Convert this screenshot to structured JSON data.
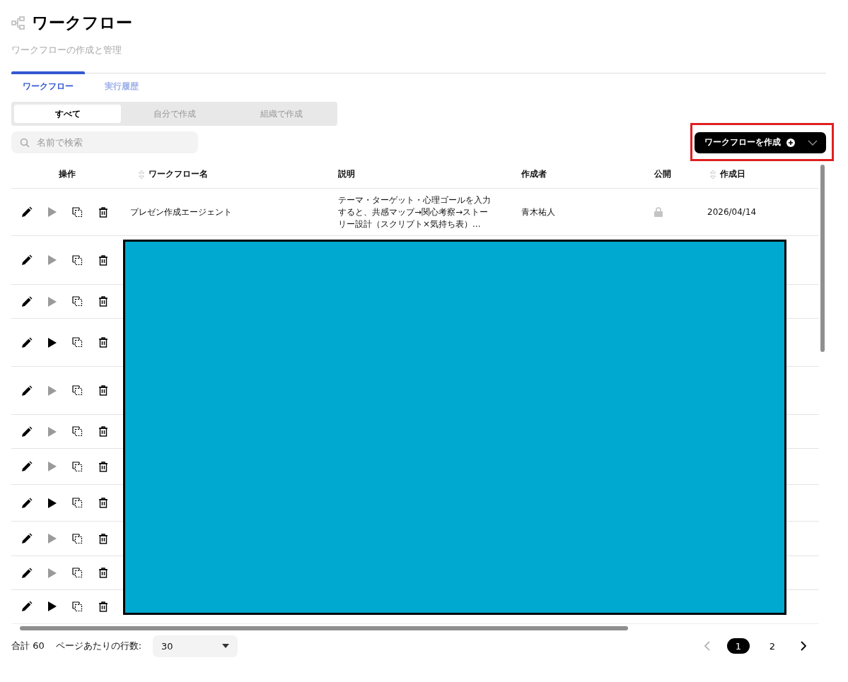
{
  "page": {
    "title": "ワークフロー",
    "subtitle": "ワークフローの作成と管理"
  },
  "tabs": [
    {
      "label": "ワークフロー",
      "selected": true
    },
    {
      "label": "実行履歴",
      "selected": false
    }
  ],
  "filters": [
    {
      "label": "すべて",
      "selected": true
    },
    {
      "label": "自分で作成",
      "selected": false
    },
    {
      "label": "組織で作成",
      "selected": false
    }
  ],
  "search": {
    "placeholder": "名前で検索"
  },
  "create_button": {
    "label": "ワークフローを作成"
  },
  "table": {
    "columns": [
      {
        "label": "操作",
        "sortable": false
      },
      {
        "label": "ワークフロー名",
        "sortable": true
      },
      {
        "label": "説明",
        "sortable": false
      },
      {
        "label": "作成者",
        "sortable": false
      },
      {
        "label": "公開",
        "sortable": false
      },
      {
        "label": "作成日",
        "sortable": true
      }
    ],
    "rows": [
      {
        "name": "プレゼン作成エージェント",
        "description": "テーマ・ターゲット・心理ゴールを入力すると、共感マップ→関心考察→ストーリー設計（スクリプト×気持ち表）...",
        "author": "青木祐人",
        "public": false,
        "date": "2026/04/14",
        "runnable": false
      },
      {
        "runnable": false
      },
      {
        "runnable": false
      },
      {
        "runnable": true
      },
      {
        "runnable": false
      },
      {
        "runnable": false
      },
      {
        "runnable": false
      },
      {
        "runnable": true
      },
      {
        "runnable": false
      },
      {
        "runnable": false
      },
      {
        "runnable": true
      }
    ]
  },
  "footer": {
    "total": "合計 60",
    "rows_label": "ページあたりの行数:",
    "rows_per_page": "30",
    "pages": [
      {
        "label": "1",
        "selected": true
      },
      {
        "label": "2",
        "selected": false
      }
    ]
  },
  "overlays": {
    "redaction_block": true,
    "highlight_frame": true
  }
}
